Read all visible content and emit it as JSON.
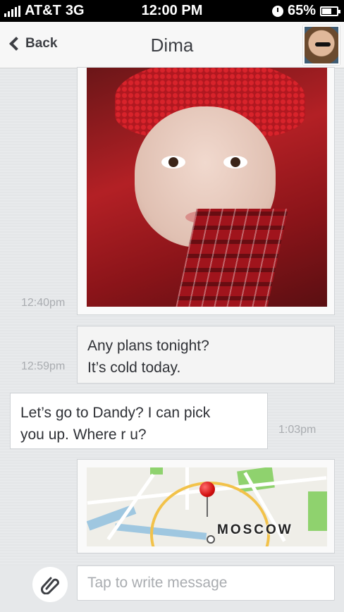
{
  "status_bar": {
    "carrier": "AT&T",
    "network": "3G",
    "time": "12:00 PM",
    "battery_percent": "65%",
    "battery_level": 0.65
  },
  "nav": {
    "back_label": "Back",
    "title": "Dima"
  },
  "messages": [
    {
      "type": "photo",
      "direction": "outgoing",
      "time": "12:40pm"
    },
    {
      "type": "text",
      "direction": "outgoing",
      "time": "12:59pm",
      "lines": [
        "Any plans tonight?",
        "It’s cold today."
      ]
    },
    {
      "type": "text",
      "direction": "incoming",
      "time": "1:03pm",
      "lines": [
        "Let’s go to Dandy? I can pick",
        "you up. Where r u?"
      ]
    },
    {
      "type": "map",
      "direction": "outgoing",
      "label": "Moscow"
    }
  ],
  "composer": {
    "placeholder": "Tap to write message"
  },
  "icons": {
    "back": "chevron-left-icon",
    "attach": "paperclip-icon",
    "pin": "map-pin-icon"
  }
}
